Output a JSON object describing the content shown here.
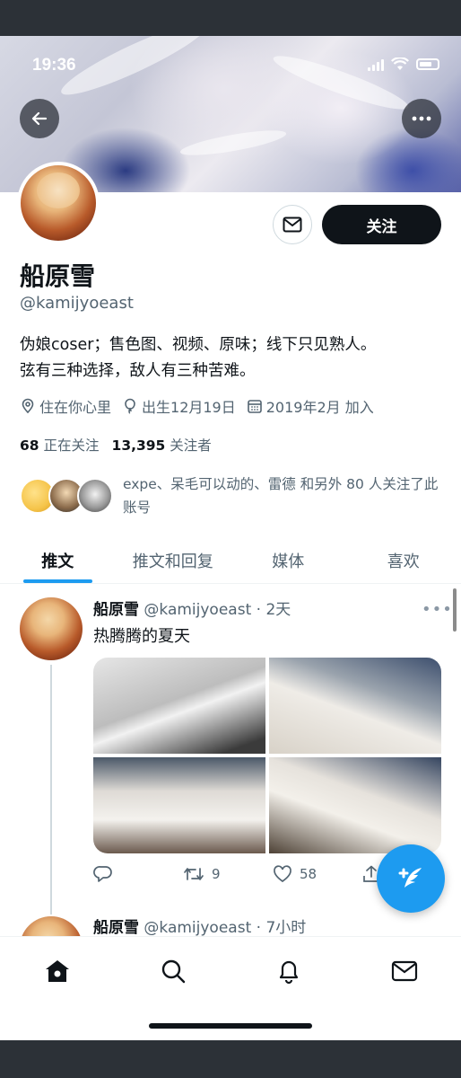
{
  "status_bar": {
    "time": "19:36"
  },
  "profile": {
    "name": "船原雪",
    "handle": "@kamijyoeast",
    "follow_label": "关注",
    "bio_lines": [
      "伪娘coser；售色图、视频、原味；线下只见熟人。",
      "弦有三种选择，敌人有三种苦难。"
    ],
    "location": "住在你心里",
    "birthday": "出生12月19日",
    "joined": "2019年2月 加入",
    "following_count": "68",
    "following_label": "正在关注",
    "followers_count": "13,395",
    "followers_label": "关注者",
    "followed_by_text": "expe、呆毛可以动的、雷德 和另外 80 人关注了此账号"
  },
  "tabs": [
    {
      "label": "推文",
      "active": true
    },
    {
      "label": "推文和回复",
      "active": false
    },
    {
      "label": "媒体",
      "active": false
    },
    {
      "label": "喜欢",
      "active": false
    }
  ],
  "tweets": [
    {
      "author": "船原雪",
      "meta": "@kamijyoeast · 2天",
      "text": "热腾腾的夏天",
      "retweets": "9",
      "likes": "58"
    },
    {
      "author": "船原雪",
      "meta": "@kamijyoeast · 7小时"
    }
  ],
  "icons": {
    "back": "back-arrow-icon",
    "more": "more-icon",
    "mail": "mail-icon",
    "location": "location-pin-icon",
    "birthday": "balloon-icon",
    "calendar": "calendar-icon",
    "reply": "reply-icon",
    "retweet": "retweet-icon",
    "like": "heart-icon",
    "share": "share-icon",
    "compose": "compose-icon",
    "nav": [
      "home-icon",
      "search-icon",
      "notifications-icon",
      "messages-icon"
    ]
  },
  "colors": {
    "accent": "#1d9bf0",
    "text": "#0f1419",
    "muted": "#536471"
  }
}
